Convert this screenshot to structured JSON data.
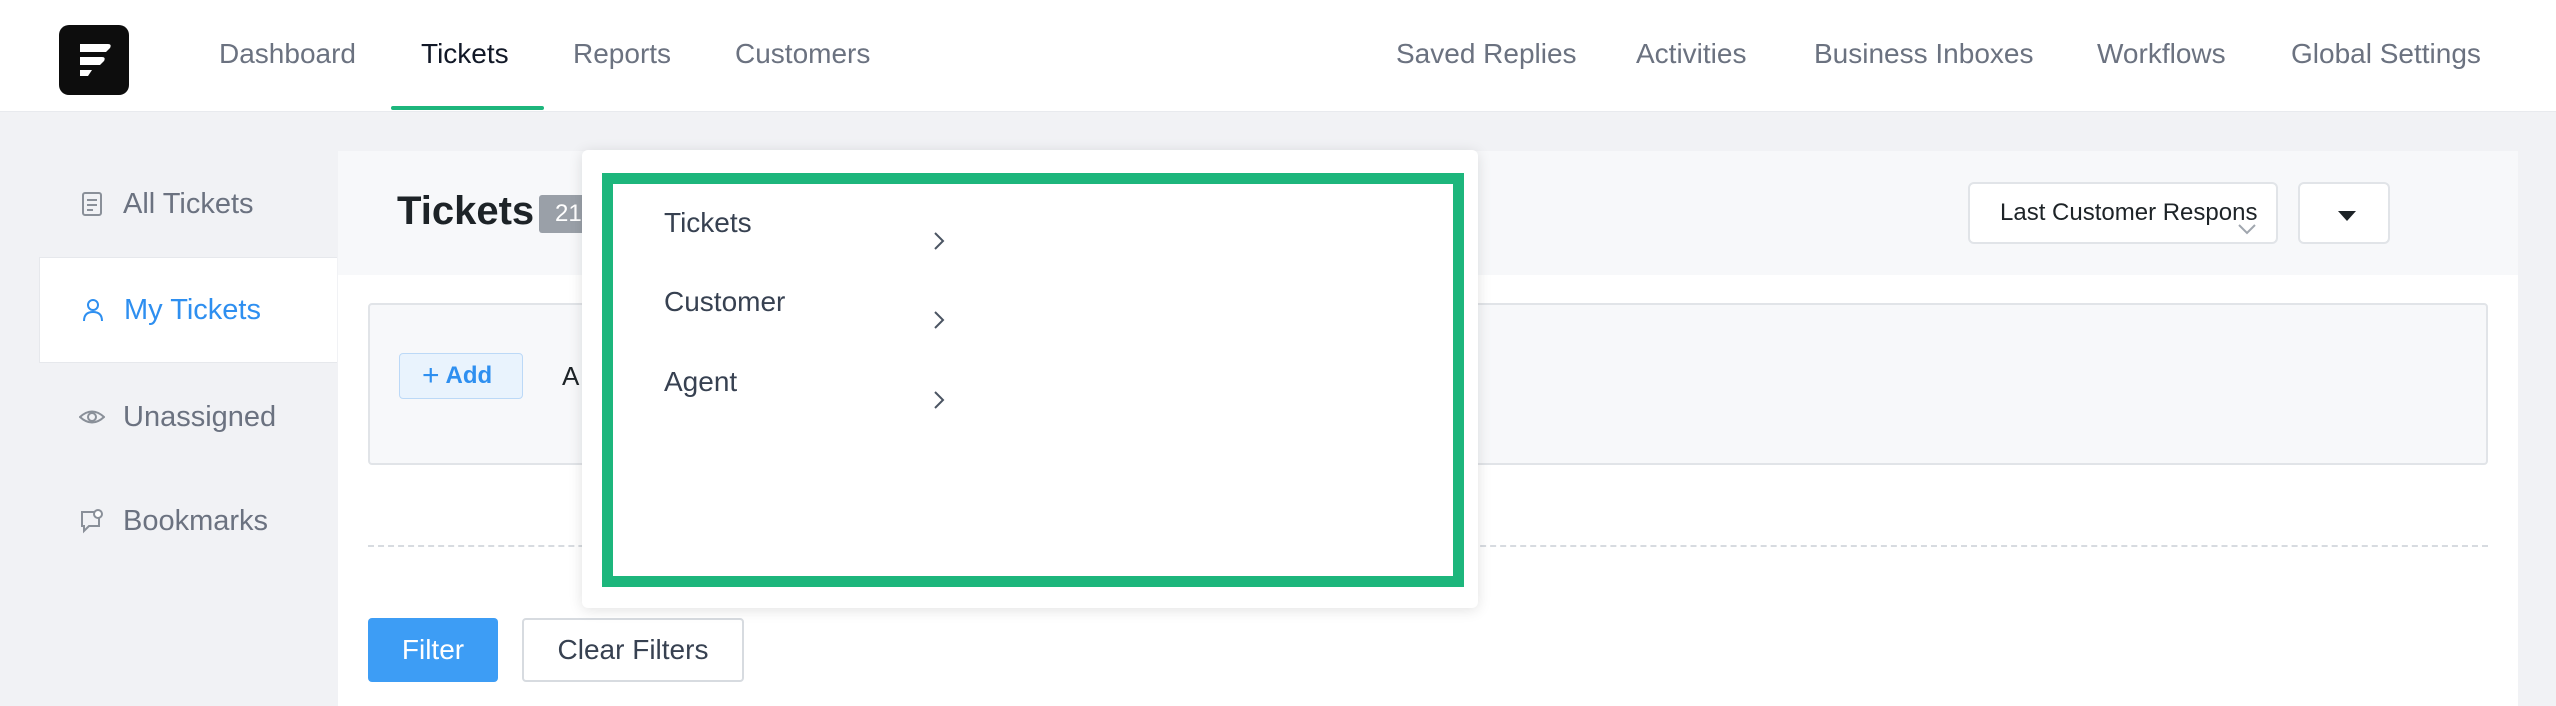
{
  "topnav": {
    "left_items": [
      {
        "label": "Dashboard"
      },
      {
        "label": "Tickets"
      },
      {
        "label": "Reports"
      },
      {
        "label": "Customers"
      }
    ],
    "active_item": "Tickets",
    "right_items": [
      {
        "label": "Saved Replies"
      },
      {
        "label": "Activities"
      },
      {
        "label": "Business Inboxes"
      },
      {
        "label": "Workflows"
      },
      {
        "label": "Global Settings"
      }
    ],
    "accent_color": "#1db67c"
  },
  "sidebar": {
    "items": [
      {
        "label": "All Tickets",
        "icon": "document-icon"
      },
      {
        "label": "My Tickets",
        "icon": "user-icon"
      },
      {
        "label": "Unassigned",
        "icon": "eye-icon"
      },
      {
        "label": "Bookmarks",
        "icon": "bookmark-chat-icon"
      }
    ],
    "active_item": "My Tickets"
  },
  "main": {
    "title": "Tickets",
    "count": "21",
    "sort_select": {
      "value": "Last Customer Respons"
    },
    "filter_builder": {
      "add_label": "Add",
      "partial_text": "A"
    },
    "filter_button": "Filter",
    "clear_filters_button": "Clear Filters"
  },
  "dropdown": {
    "items": [
      {
        "label": "Tickets"
      },
      {
        "label": "Customer"
      },
      {
        "label": "Agent"
      }
    ]
  },
  "colors": {
    "primary_button": "#3d9df5",
    "active_sidebar": "#2e8ff0",
    "highlight_frame": "#1db67c"
  }
}
